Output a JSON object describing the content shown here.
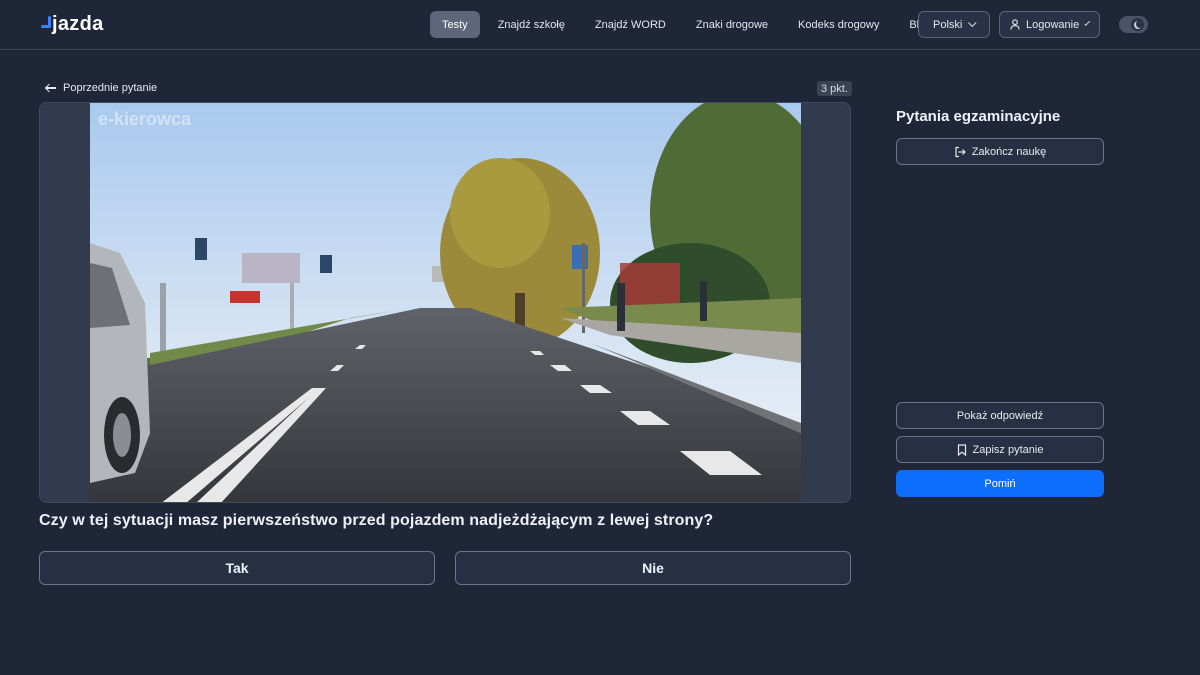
{
  "brand": {
    "name": "jazda"
  },
  "nav": {
    "items": [
      {
        "label": "Testy",
        "active": true
      },
      {
        "label": "Znajdź szkołę",
        "active": false
      },
      {
        "label": "Znajdź WORD",
        "active": false
      },
      {
        "label": "Znaki drogowe",
        "active": false
      },
      {
        "label": "Kodeks drogowy",
        "active": false
      },
      {
        "label": "Blog",
        "active": false
      }
    ],
    "language": "Polski",
    "login": "Logowanie",
    "theme_toggle_icon": "moon-icon"
  },
  "question_panel": {
    "back_label": "Poprzednie pytanie",
    "points": "3 pkt.",
    "media_watermark": "e-kierowca",
    "question": "Czy w tej sytuacji masz pierwszeństwo przed pojazdem nadjeżdżającym z lewej strony?",
    "answers": [
      "Tak",
      "Nie"
    ]
  },
  "sidebar": {
    "title": "Pytania egzaminacyjne",
    "end_label": "Zakończ naukę",
    "show_answer_label": "Pokaż odpowiedź",
    "save_label": "Zapisz pytanie",
    "skip_label": "Pomiń"
  },
  "colors": {
    "background": "#1f2637",
    "accent": "#0d6efd",
    "brand_mark": "#3b82f6",
    "active_tab": "#5d6779"
  }
}
